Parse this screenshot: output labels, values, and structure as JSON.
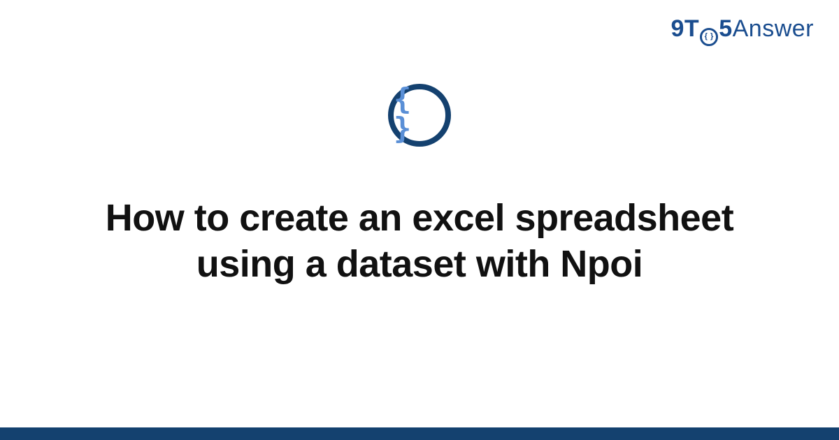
{
  "brand": {
    "nine": "9",
    "to_t": "T",
    "to_o_inner": "{ }",
    "five": "5",
    "answer": "Answer"
  },
  "badge": {
    "glyph": "{ }"
  },
  "title": "How to create an excel spreadsheet using a dataset with Npoi"
}
